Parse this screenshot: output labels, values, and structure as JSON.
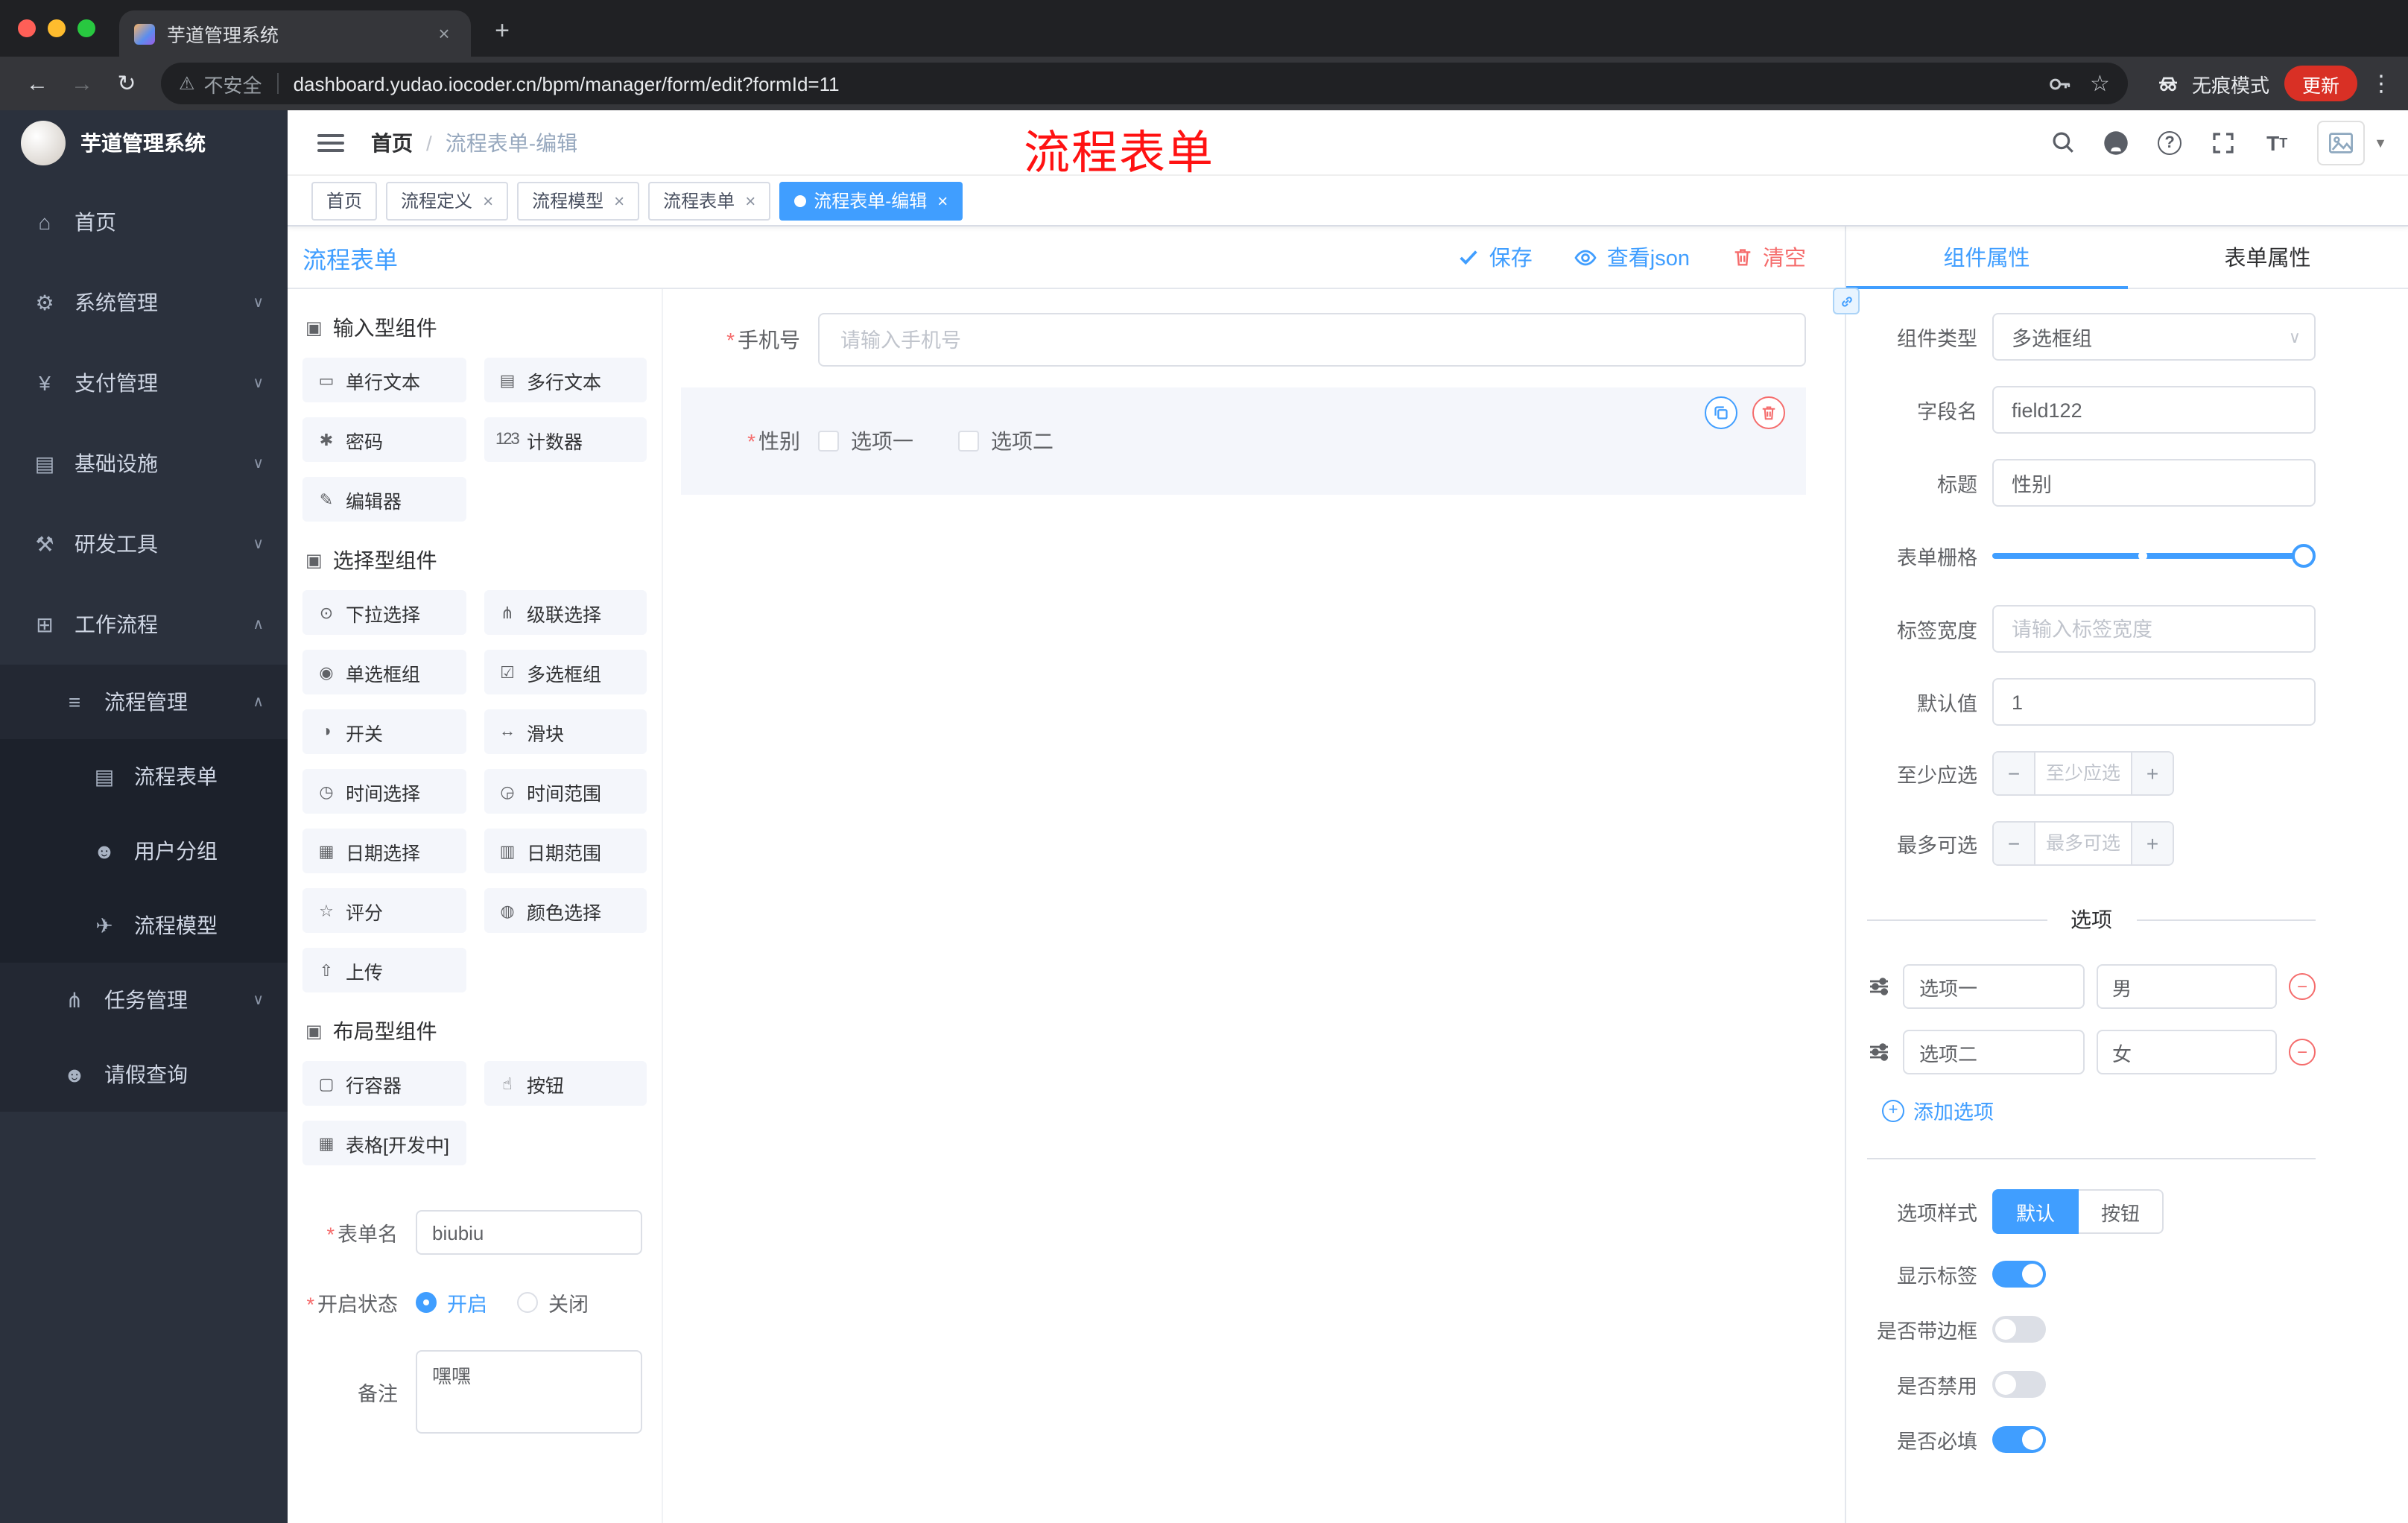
{
  "symbols": {
    "close": "×",
    "plus": "+",
    "minus": "−",
    "back": "←",
    "forward": "→",
    "reload": "↻",
    "warning": "⚠",
    "star": "☆",
    "kebab": "⋮",
    "caret_down": "∨",
    "caret_solid": "▼",
    "question": "?",
    "font_letter": "T"
  },
  "required_mark": "*",
  "browser": {
    "tab_title": "芋道管理系统",
    "security_label": "不安全",
    "url": "dashboard.yudao.iocoder.cn/bpm/manager/form/edit?formId=11",
    "incognito_label": "无痕模式",
    "update_label": "更新"
  },
  "sidebar": {
    "logo_title": "芋道管理系统",
    "items": [
      {
        "glyph": "⌂",
        "label": "首页"
      },
      {
        "glyph": "⚙",
        "label": "系统管理",
        "chevron": "∨"
      },
      {
        "glyph": "¥",
        "label": "支付管理",
        "chevron": "∨"
      },
      {
        "glyph": "▤",
        "label": "基础设施",
        "chevron": "∨"
      },
      {
        "glyph": "⚒",
        "label": "研发工具",
        "chevron": "∨"
      },
      {
        "glyph": "⊞",
        "label": "工作流程",
        "chevron": "∧"
      },
      {
        "glyph": "≡",
        "label": "流程管理",
        "chevron": "∧"
      },
      {
        "glyph": "▤",
        "label": "流程表单"
      },
      {
        "glyph": "☻",
        "label": "用户分组"
      },
      {
        "glyph": "✈",
        "label": "流程模型"
      },
      {
        "glyph": "⋔",
        "label": "任务管理",
        "chevron": "∨"
      },
      {
        "glyph": "☻",
        "label": "请假查询"
      }
    ]
  },
  "header": {
    "breadcrumb_home": "首页",
    "breadcrumb_sep": "/",
    "breadcrumb_current": "流程表单-编辑",
    "annotation": "流程表单"
  },
  "tags": {
    "t0": "首页",
    "t1": "流程定义",
    "t2": "流程模型",
    "t3": "流程表单",
    "t4": "流程表单-编辑"
  },
  "designer": {
    "title": "流程表单",
    "save": "保存",
    "view_json": "查看json",
    "clear": "清空",
    "palette": {
      "sec_icon": "▣",
      "sec_input": "输入型组件",
      "sec_select": "选择型组件",
      "sec_layout": "布局型组件",
      "input_items": [
        {
          "glyph": "▭",
          "label": "单行文本"
        },
        {
          "glyph": "▤",
          "label": "多行文本"
        },
        {
          "glyph": "✱",
          "label": "密码"
        },
        {
          "glyph": "123",
          "label": "计数器"
        },
        {
          "glyph": "✎",
          "label": "编辑器"
        }
      ],
      "select_items": [
        {
          "glyph": "⊙",
          "label": "下拉选择"
        },
        {
          "glyph": "⋔",
          "label": "级联选择"
        },
        {
          "glyph": "◉",
          "label": "单选框组"
        },
        {
          "glyph": "☑",
          "label": "多选框组"
        },
        {
          "glyph": "◑",
          "label": "开关"
        },
        {
          "glyph": "↔",
          "label": "滑块"
        },
        {
          "glyph": "◷",
          "label": "时间选择"
        },
        {
          "glyph": "◶",
          "label": "时间范围"
        },
        {
          "glyph": "▦",
          "label": "日期选择"
        },
        {
          "glyph": "▥",
          "label": "日期范围"
        },
        {
          "glyph": "☆",
          "label": "评分"
        },
        {
          "glyph": "◍",
          "label": "颜色选择"
        },
        {
          "glyph": "⇧",
          "label": "上传"
        }
      ],
      "layout_items": [
        {
          "glyph": "▢",
          "label": "行容器"
        },
        {
          "glyph": "☝",
          "label": "按钮"
        },
        {
          "glyph": "▦",
          "label": "表格[开发中]"
        }
      ]
    },
    "meta": {
      "form_name_label": "表单名",
      "form_name_value": "biubiu",
      "status_label": "开启状态",
      "status_on": "开启",
      "status_off": "关闭",
      "remark_label": "备注",
      "remark_value": "嘿嘿"
    },
    "canvas": {
      "phone_label": "手机号",
      "phone_placeholder": "请输入手机号",
      "gender_label": "性别",
      "opt1": "选项一",
      "opt2": "选项二"
    }
  },
  "inspector": {
    "tab_component": "组件属性",
    "tab_form": "表单属性",
    "component_type_label": "组件类型",
    "component_type_value": "多选框组",
    "field_name_label": "字段名",
    "field_name_value": "field122",
    "title_label": "标题",
    "title_value": "性别",
    "grid_label": "表单栅格",
    "label_width_label": "标签宽度",
    "label_width_placeholder": "请输入标签宽度",
    "default_label": "默认值",
    "default_value": "1",
    "min_label": "至少应选",
    "min_placeholder": "至少应选",
    "max_label": "最多可选",
    "max_placeholder": "最多可选",
    "options_divider": "选项",
    "options": [
      {
        "label": "选项一",
        "value": "男"
      },
      {
        "label": "选项二",
        "value": "女"
      }
    ],
    "add_option": "添加选项",
    "style_label": "选项样式",
    "style_default": "默认",
    "style_button": "按钮",
    "switches": [
      {
        "label": "显示标签",
        "on": true
      },
      {
        "label": "是否带边框",
        "on": false
      },
      {
        "label": "是否禁用",
        "on": false
      },
      {
        "label": "是否必填",
        "on": true
      }
    ]
  },
  "colors": {
    "primary": "#409eff",
    "danger": "#f56c6c",
    "annotation": "#ff1212"
  }
}
